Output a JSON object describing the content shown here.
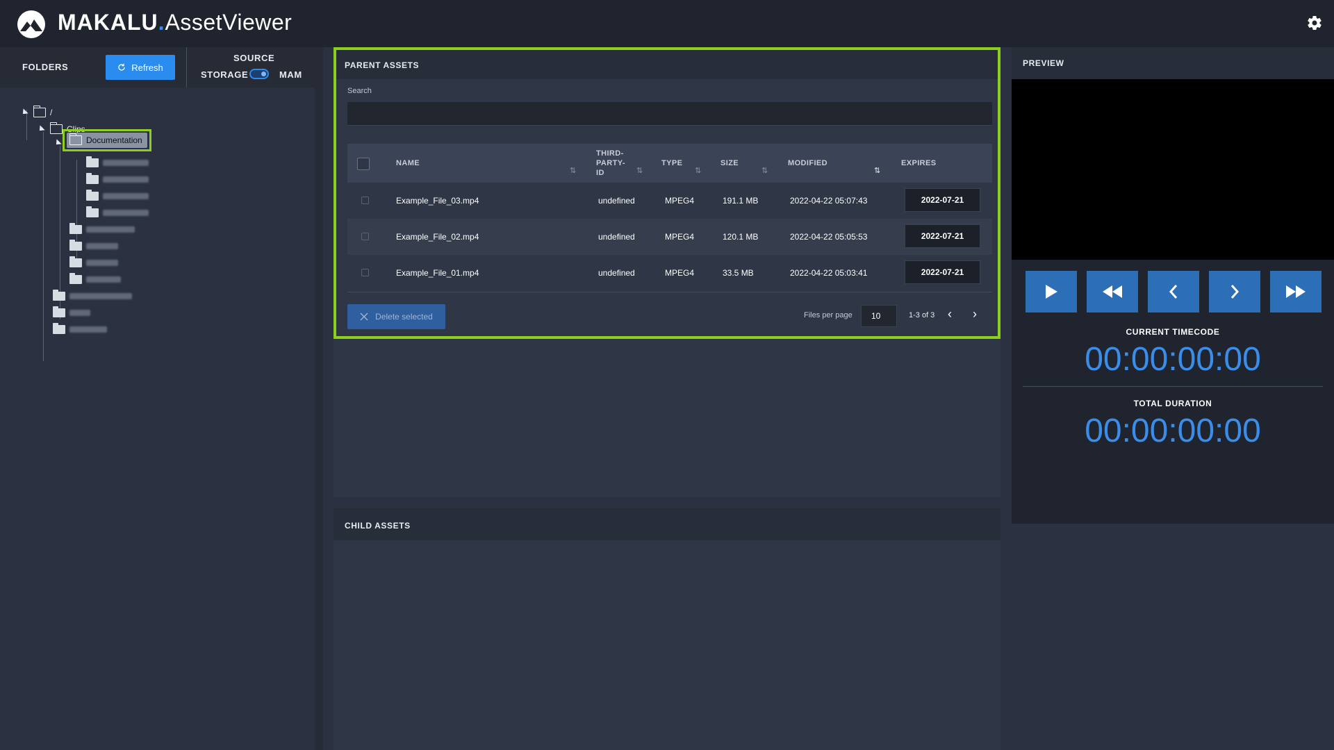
{
  "app": {
    "brand": "MAKALU",
    "dot": ".",
    "product": "AssetViewer"
  },
  "colors": {
    "accent": "#3b8dea",
    "highlight": "#8ccf1d",
    "button": "#2b8cf0"
  },
  "left_panel": {
    "folders_label": "FOLDERS",
    "refresh_label": "Refresh",
    "source_label": "SOURCE",
    "storage_label": "STORAGE",
    "mam_label": "MAM",
    "tree": {
      "root": "/",
      "clips": "Clips",
      "documentation": "Documentation"
    }
  },
  "parent_assets": {
    "title": "PARENT ASSETS",
    "search_label": "Search",
    "search_value": "",
    "columns": {
      "name": "NAME",
      "third_party_1": "THIRD-",
      "third_party_2": "PARTY-",
      "third_party_3": "ID",
      "type": "TYPE",
      "size": "SIZE",
      "modified": "MODIFIED",
      "expires": "EXPIRES"
    },
    "rows": [
      {
        "name": "Example_File_03.mp4",
        "third_party_id": "undefined",
        "type": "MPEG4",
        "size": "191.1 MB",
        "modified": "2022-04-22 05:07:43",
        "expires": "2022-07-21"
      },
      {
        "name": "Example_File_02.mp4",
        "third_party_id": "undefined",
        "type": "MPEG4",
        "size": "120.1 MB",
        "modified": "2022-04-22 05:05:53",
        "expires": "2022-07-21"
      },
      {
        "name": "Example_File_01.mp4",
        "third_party_id": "undefined",
        "type": "MPEG4",
        "size": "33.5 MB",
        "modified": "2022-04-22 05:03:41",
        "expires": "2022-07-21"
      }
    ],
    "delete_label": "Delete selected",
    "files_per_page_label": "Files per page",
    "files_per_page": "10",
    "range": "1-3 of 3"
  },
  "child_assets": {
    "title": "CHILD ASSETS"
  },
  "preview": {
    "title": "PREVIEW",
    "current_timecode_label": "CURRENT TIMECODE",
    "current_timecode": "00:00:00:00",
    "total_duration_label": "TOTAL DURATION",
    "total_duration": "00:00:00:00"
  }
}
